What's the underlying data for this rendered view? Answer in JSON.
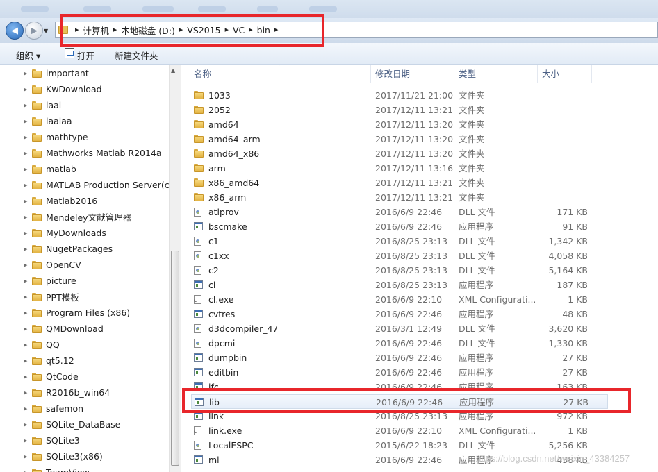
{
  "address": {
    "crumbs": [
      "计算机",
      "本地磁盘 (D:)",
      "VS2015",
      "VC",
      "bin"
    ]
  },
  "toolbar": {
    "organize_label": "组织 ▾",
    "open_label": "打开",
    "new_folder_label": "新建文件夹"
  },
  "tree": {
    "items": [
      "important",
      "KwDownload",
      "laal",
      "laalaa",
      "mathtype",
      "Mathworks Matlab R2014a",
      "matlab",
      "MATLAB Production Server(cra",
      "Matlab2016",
      "Mendeley文献管理器",
      "MyDownloads",
      "NugetPackages",
      "OpenCV",
      "picture",
      "PPT模板",
      "Program Files (x86)",
      "QMDownload",
      "QQ",
      "qt5.12",
      "QtCode",
      "R2016b_win64",
      "safemon",
      "SQLite_DataBase",
      "SQLite3",
      "SQLite3(x86)",
      "TeamView"
    ]
  },
  "columns": {
    "name": "名称",
    "date": "修改日期",
    "type": "类型",
    "size": "大小"
  },
  "files": [
    {
      "icon": "folder-icon",
      "name": "1033",
      "date": "2017/11/21 21:00",
      "type": "文件夹",
      "size": ""
    },
    {
      "icon": "folder-icon",
      "name": "2052",
      "date": "2017/12/11 13:21",
      "type": "文件夹",
      "size": ""
    },
    {
      "icon": "folder-icon",
      "name": "amd64",
      "date": "2017/12/11 13:20",
      "type": "文件夹",
      "size": ""
    },
    {
      "icon": "folder-icon",
      "name": "amd64_arm",
      "date": "2017/12/11 13:20",
      "type": "文件夹",
      "size": ""
    },
    {
      "icon": "folder-icon",
      "name": "amd64_x86",
      "date": "2017/12/11 13:20",
      "type": "文件夹",
      "size": ""
    },
    {
      "icon": "folder-icon",
      "name": "arm",
      "date": "2017/12/11 13:16",
      "type": "文件夹",
      "size": ""
    },
    {
      "icon": "folder-icon",
      "name": "x86_amd64",
      "date": "2017/12/11 13:21",
      "type": "文件夹",
      "size": ""
    },
    {
      "icon": "folder-icon",
      "name": "x86_arm",
      "date": "2017/12/11 13:21",
      "type": "文件夹",
      "size": ""
    },
    {
      "icon": "dll-icon",
      "name": "atlprov",
      "date": "2016/6/9 22:46",
      "type": "DLL 文件",
      "size": "171 KB"
    },
    {
      "icon": "app-icon",
      "name": "bscmake",
      "date": "2016/6/9 22:46",
      "type": "应用程序",
      "size": "91 KB"
    },
    {
      "icon": "dll-icon",
      "name": "c1",
      "date": "2016/8/25 23:13",
      "type": "DLL 文件",
      "size": "1,342 KB"
    },
    {
      "icon": "dll-icon",
      "name": "c1xx",
      "date": "2016/8/25 23:13",
      "type": "DLL 文件",
      "size": "4,058 KB"
    },
    {
      "icon": "dll-icon",
      "name": "c2",
      "date": "2016/8/25 23:13",
      "type": "DLL 文件",
      "size": "5,164 KB"
    },
    {
      "icon": "app-icon",
      "name": "cl",
      "date": "2016/8/25 23:13",
      "type": "应用程序",
      "size": "187 KB"
    },
    {
      "icon": "xml-icon",
      "name": "cl.exe",
      "date": "2016/6/9 22:10",
      "type": "XML Configurati...",
      "size": "1 KB"
    },
    {
      "icon": "app-icon",
      "name": "cvtres",
      "date": "2016/6/9 22:46",
      "type": "应用程序",
      "size": "48 KB"
    },
    {
      "icon": "dll-icon",
      "name": "d3dcompiler_47",
      "date": "2016/3/1 12:49",
      "type": "DLL 文件",
      "size": "3,620 KB"
    },
    {
      "icon": "dll-icon",
      "name": "dpcmi",
      "date": "2016/6/9 22:46",
      "type": "DLL 文件",
      "size": "1,330 KB"
    },
    {
      "icon": "app-icon",
      "name": "dumpbin",
      "date": "2016/6/9 22:46",
      "type": "应用程序",
      "size": "27 KB"
    },
    {
      "icon": "app-icon",
      "name": "editbin",
      "date": "2016/6/9 22:46",
      "type": "应用程序",
      "size": "27 KB"
    },
    {
      "icon": "app-icon",
      "name": "ifc",
      "date": "2016/6/9 22:46",
      "type": "应用程序",
      "size": "163 KB"
    },
    {
      "icon": "app-icon",
      "name": "lib",
      "date": "2016/6/9 22:46",
      "type": "应用程序",
      "size": "27 KB",
      "selected": true
    },
    {
      "icon": "app-icon",
      "name": "link",
      "date": "2016/8/25 23:13",
      "type": "应用程序",
      "size": "972 KB"
    },
    {
      "icon": "xml-icon",
      "name": "link.exe",
      "date": "2016/6/9 22:10",
      "type": "XML Configurati...",
      "size": "1 KB"
    },
    {
      "icon": "dll-icon",
      "name": "LocalESPC",
      "date": "2015/6/22 18:23",
      "type": "DLL 文件",
      "size": "5,256 KB"
    },
    {
      "icon": "app-icon",
      "name": "ml",
      "date": "2016/6/9 22:46",
      "type": "应用程序",
      "size": "438 KB"
    }
  ],
  "watermark": "https://blog.csdn.net/weixin_43384257",
  "colors": {
    "highlight": "#e8262b",
    "header_text": "#4d6185",
    "folder": "#e3b444"
  }
}
